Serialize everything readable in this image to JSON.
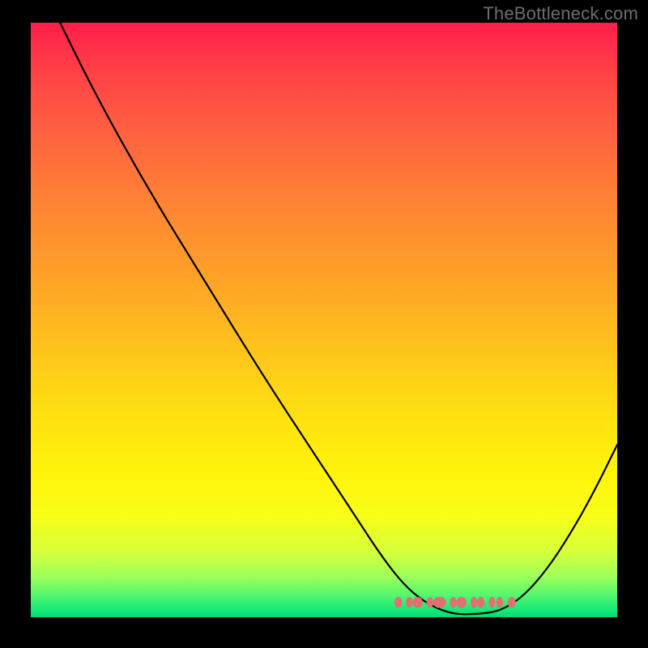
{
  "attribution": "TheBottleneck.com",
  "chart_data": {
    "type": "line",
    "title": "",
    "xlabel": "",
    "ylabel": "",
    "x_range": [
      0,
      100
    ],
    "y_range": [
      0,
      100
    ],
    "background_gradient": {
      "top": "#ff1e49",
      "bottom": "#03d978"
    },
    "series": [
      {
        "name": "bottleneck-curve",
        "color": "#000000",
        "points": [
          {
            "x": 5.0,
            "y": 100.0
          },
          {
            "x": 11.0,
            "y": 88.0
          },
          {
            "x": 20.0,
            "y": 72.0
          },
          {
            "x": 30.0,
            "y": 56.0
          },
          {
            "x": 40.0,
            "y": 40.0
          },
          {
            "x": 50.0,
            "y": 25.0
          },
          {
            "x": 56.0,
            "y": 16.0
          },
          {
            "x": 60.0,
            "y": 10.0
          },
          {
            "x": 64.0,
            "y": 5.0
          },
          {
            "x": 68.0,
            "y": 2.0
          },
          {
            "x": 72.0,
            "y": 0.5
          },
          {
            "x": 76.0,
            "y": 0.5
          },
          {
            "x": 80.0,
            "y": 1.0
          },
          {
            "x": 84.0,
            "y": 3.5
          },
          {
            "x": 88.0,
            "y": 8.0
          },
          {
            "x": 92.0,
            "y": 14.0
          },
          {
            "x": 96.0,
            "y": 21.0
          },
          {
            "x": 100.0,
            "y": 29.0
          }
        ]
      }
    ],
    "optimal_marker": {
      "color": "#e27070",
      "x_range": [
        62,
        84
      ],
      "y": 2.5
    }
  }
}
